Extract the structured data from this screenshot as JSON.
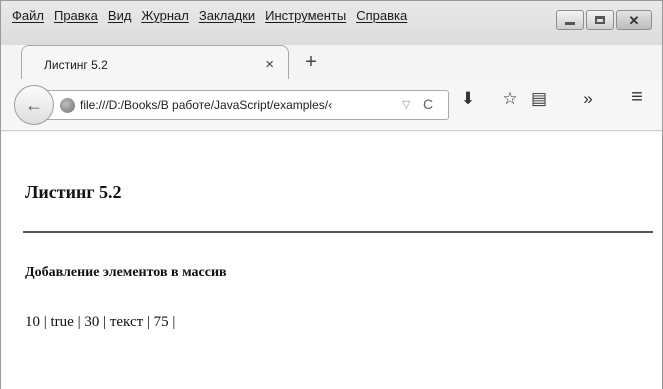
{
  "menu": [
    "Файл",
    "Правка",
    "Вид",
    "Журнал",
    "Закладки",
    "Инструменты",
    "Справка"
  ],
  "tab": {
    "title": "Листинг 5.2",
    "close_glyph": "×",
    "new_tab_glyph": "+"
  },
  "navbar": {
    "url": "file:///D:/Books/В работе/JavaScript/examples/‹",
    "dropdown_glyph": "▽",
    "reload_glyph": "C",
    "back_glyph": "←",
    "icons": [
      "download-icon",
      "bookmark-star-icon",
      "reading-list-icon",
      "overflow-icon",
      "menu-icon"
    ],
    "download_glyph": "⬇",
    "star_glyph": "☆",
    "list_glyph": "▤",
    "overflow_glyph": "»",
    "menu_glyph": "≡"
  },
  "page": {
    "heading": "Листинг 5.2",
    "subheading": "Добавление элементов в массив",
    "output": "10 | true | 30 | текст | 75 |"
  },
  "window_controls": {
    "close_glyph": "✕"
  }
}
